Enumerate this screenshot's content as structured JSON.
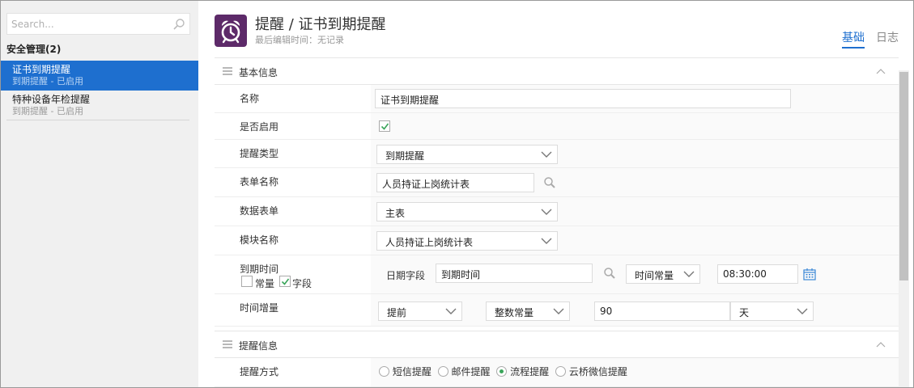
{
  "sidebar": {
    "search_placeholder": "Search...",
    "group_title": "安全管理(2)",
    "items": [
      {
        "title": "证书到期提醒",
        "sub": "到期提醒 - 已启用",
        "active": true
      },
      {
        "title": "特种设备年检提醒",
        "sub": "到期提醒 - 已启用",
        "active": false
      }
    ]
  },
  "header": {
    "title": "提醒 / 证书到期提醒",
    "subtitle": "最后编辑时间：无记录",
    "icon": "alarm-clock-icon",
    "icon_bg": "#5d2a69",
    "tabs": [
      {
        "label": "基础",
        "active": true
      },
      {
        "label": "日志",
        "active": false
      }
    ]
  },
  "basic_section": {
    "title": "基本信息",
    "fields": {
      "name": {
        "label": "名称",
        "value": "证书到期提醒"
      },
      "enabled": {
        "label": "是否启用",
        "checked": true
      },
      "remind_type": {
        "label": "提醒类型",
        "value": "到期提醒"
      },
      "form_name": {
        "label": "表单名称",
        "value": "人员持证上岗统计表"
      },
      "data_form": {
        "label": "数据表单",
        "value": "主表"
      },
      "module_name": {
        "label": "模块名称",
        "value": "人员持证上岗统计表"
      },
      "due_time": {
        "label": "到期时间",
        "const_label": "常量",
        "const_checked": false,
        "field_label": "字段",
        "field_checked": true,
        "date_field_label": "日期字段",
        "date_field_value": "到期时间",
        "time_type": "时间常量",
        "time_value": "08:30:00"
      },
      "time_increment": {
        "label": "时间增量",
        "direction": "提前",
        "value_type": "整数常量",
        "amount": "90",
        "unit": "天"
      }
    }
  },
  "remind_section": {
    "title": "提醒信息",
    "method_label": "提醒方式",
    "methods": [
      {
        "label": "短信提醒",
        "checked": false
      },
      {
        "label": "邮件提醒",
        "checked": false
      },
      {
        "label": "流程提醒",
        "checked": true
      },
      {
        "label": "云桥微信提醒",
        "checked": false
      }
    ]
  },
  "colors": {
    "accent": "#1e6fcf",
    "sidebar_bg": "#f0f0f0",
    "check_green": "#3aa55a"
  }
}
